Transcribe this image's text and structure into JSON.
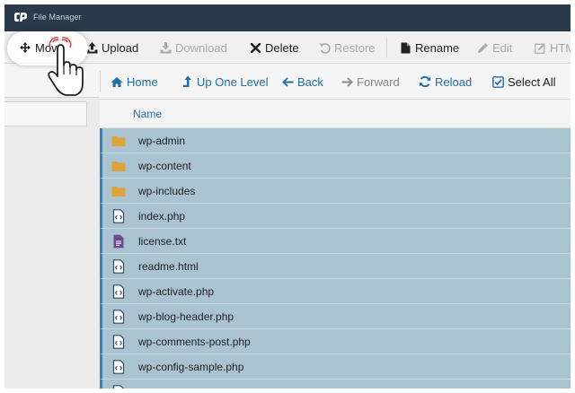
{
  "app": {
    "title": "File Manager",
    "logo_text": "cP"
  },
  "toolbar": {
    "move": "Move",
    "upload": "Upload",
    "download": "Download",
    "delete": "Delete",
    "restore": "Restore",
    "rename": "Rename",
    "edit": "Edit",
    "html_editor": "HTML Editor"
  },
  "nav": {
    "home": "Home",
    "up_one_level": "Up One Level",
    "back": "Back",
    "forward": "Forward",
    "reload": "Reload",
    "select_all": "Select All"
  },
  "table": {
    "col_name": "Name"
  },
  "files": [
    {
      "name": "wp-admin",
      "type": "folder"
    },
    {
      "name": "wp-content",
      "type": "folder"
    },
    {
      "name": "wp-includes",
      "type": "folder"
    },
    {
      "name": "index.php",
      "type": "code"
    },
    {
      "name": "license.txt",
      "type": "text"
    },
    {
      "name": "readme.html",
      "type": "code"
    },
    {
      "name": "wp-activate.php",
      "type": "code"
    },
    {
      "name": "wp-blog-header.php",
      "type": "code"
    },
    {
      "name": "wp-comments-post.php",
      "type": "code"
    },
    {
      "name": "wp-config-sample.php",
      "type": "code"
    },
    {
      "name": "",
      "type": "code"
    }
  ],
  "colors": {
    "titlebar": "#293a4a",
    "selection": "#a9c3d1",
    "selection_border": "#2b86c5",
    "link": "#1f6fa8",
    "folder": "#e0a33a",
    "text_file": "#6b4a93"
  }
}
